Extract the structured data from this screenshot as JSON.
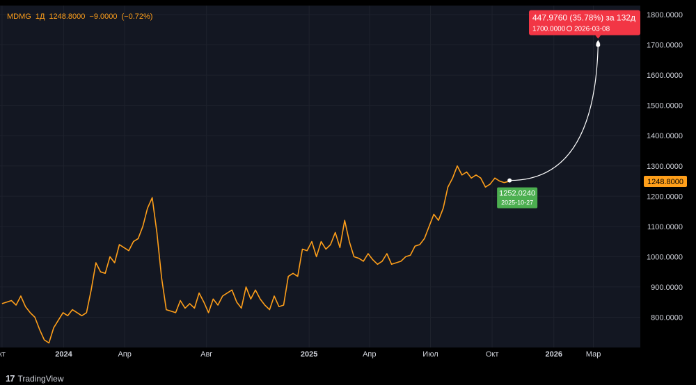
{
  "legend": {
    "symbol": "MDMG",
    "interval": "1Д",
    "last": "1248.8000",
    "change": "−9.0000",
    "change_pct": "(−0.72%)"
  },
  "brand": {
    "name": "TradingView"
  },
  "colors": {
    "line": "#ff9f1a",
    "grid": "#1e222d",
    "plot_bg": "#131722",
    "start_marker": "#4caf50",
    "target_marker": "#f23645",
    "projection": "#ffffff"
  },
  "chart_data": {
    "type": "line",
    "series": [
      {
        "name": "MDMG",
        "x": [
          "2023-10-01",
          "2023-10-08",
          "2023-10-15",
          "2023-10-22",
          "2023-10-29",
          "2023-11-05",
          "2023-11-12",
          "2023-11-19",
          "2023-11-26",
          "2023-12-03",
          "2023-12-10",
          "2023-12-17",
          "2023-12-24",
          "2023-12-31",
          "2024-01-07",
          "2024-01-14",
          "2024-01-21",
          "2024-01-28",
          "2024-02-04",
          "2024-02-11",
          "2024-02-18",
          "2024-02-25",
          "2024-03-03",
          "2024-03-10",
          "2024-03-17",
          "2024-03-24",
          "2024-03-31",
          "2024-04-07",
          "2024-04-14",
          "2024-04-21",
          "2024-04-28",
          "2024-05-05",
          "2024-05-12",
          "2024-05-19",
          "2024-05-26",
          "2024-06-02",
          "2024-06-09",
          "2024-06-16",
          "2024-06-23",
          "2024-06-30",
          "2024-07-07",
          "2024-07-14",
          "2024-07-21",
          "2024-07-28",
          "2024-08-04",
          "2024-08-11",
          "2024-08-18",
          "2024-08-25",
          "2024-09-01",
          "2024-09-08",
          "2024-09-15",
          "2024-09-22",
          "2024-09-29",
          "2024-10-06",
          "2024-10-13",
          "2024-10-20",
          "2024-10-27",
          "2024-11-03",
          "2024-11-10",
          "2024-11-17",
          "2024-11-24",
          "2024-12-01",
          "2024-12-08",
          "2024-12-15",
          "2024-12-22",
          "2024-12-29",
          "2025-01-05",
          "2025-01-12",
          "2025-01-19",
          "2025-01-26",
          "2025-02-02",
          "2025-02-09",
          "2025-02-16",
          "2025-02-23",
          "2025-03-02",
          "2025-03-09",
          "2025-03-16",
          "2025-03-23",
          "2025-03-30",
          "2025-04-06",
          "2025-04-13",
          "2025-04-20",
          "2025-04-27",
          "2025-05-04",
          "2025-05-11",
          "2025-05-18",
          "2025-05-25",
          "2025-06-01",
          "2025-06-08",
          "2025-06-15",
          "2025-06-22",
          "2025-06-29",
          "2025-07-06",
          "2025-07-13",
          "2025-07-20",
          "2025-07-27",
          "2025-08-03",
          "2025-08-10",
          "2025-08-17",
          "2025-08-24",
          "2025-08-31",
          "2025-09-07",
          "2025-09-14",
          "2025-09-21",
          "2025-09-28",
          "2025-10-05",
          "2025-10-12",
          "2025-10-19",
          "2025-10-26"
        ],
        "values": [
          845,
          850,
          855,
          840,
          870,
          835,
          815,
          800,
          760,
          725,
          715,
          765,
          790,
          815,
          805,
          825,
          815,
          805,
          815,
          890,
          980,
          950,
          945,
          1000,
          980,
          1040,
          1030,
          1020,
          1050,
          1060,
          1100,
          1160,
          1195,
          1080,
          930,
          825,
          820,
          815,
          855,
          830,
          845,
          830,
          880,
          850,
          815,
          860,
          840,
          870,
          880,
          890,
          850,
          830,
          900,
          860,
          890,
          860,
          840,
          825,
          870,
          835,
          840,
          935,
          945,
          935,
          1025,
          1020,
          1050,
          1000,
          1050,
          1025,
          1040,
          1080,
          1030,
          1120,
          1050,
          1000,
          995,
          985,
          1010,
          990,
          975,
          985,
          1010,
          975,
          980,
          985,
          1000,
          1005,
          1035,
          1040,
          1060,
          1100,
          1140,
          1120,
          1160,
          1230,
          1260,
          1300,
          1270,
          1280,
          1260,
          1270,
          1260,
          1230,
          1240,
          1260,
          1250,
          1245,
          1249
        ]
      }
    ],
    "y_ticks": [
      "800.0000",
      "900.0000",
      "1000.0000",
      "1100.0000",
      "1200.0000",
      "1300.0000",
      "1400.0000",
      "1500.0000",
      "1600.0000",
      "1700.0000",
      "1800.0000"
    ],
    "ylim": [
      700,
      1830
    ],
    "x_ticks": [
      {
        "label": "кт",
        "date": "2023-10-01",
        "bold": false
      },
      {
        "label": "2024",
        "date": "2024-01-01",
        "bold": true
      },
      {
        "label": "Апр",
        "date": "2024-04-01",
        "bold": false
      },
      {
        "label": "Авг",
        "date": "2024-08-01",
        "bold": false
      },
      {
        "label": "2025",
        "date": "2025-01-01",
        "bold": true
      },
      {
        "label": "Апр",
        "date": "2025-04-01",
        "bold": false
      },
      {
        "label": "Июл",
        "date": "2025-07-01",
        "bold": false
      },
      {
        "label": "Окт",
        "date": "2025-10-01",
        "bold": false
      },
      {
        "label": "2026",
        "date": "2026-01-01",
        "bold": true
      },
      {
        "label": "Мар",
        "date": "2026-03-01",
        "bold": false
      }
    ],
    "xlim": [
      "2023-09-28",
      "2026-05-10"
    ],
    "last_price_label": "1248.8000",
    "projection": {
      "start": {
        "date": "2025-10-27",
        "value": 1252.024,
        "price_label": "1252.0240",
        "date_label": "2025-10-27"
      },
      "end": {
        "date": "2026-03-08",
        "value": 1700.0,
        "price_label": "1700.0000",
        "date_label": "2026-03-08"
      },
      "change_text": "447.9760 (35.78%) за 132д"
    },
    "grid": true,
    "legend_position": "top-left"
  }
}
